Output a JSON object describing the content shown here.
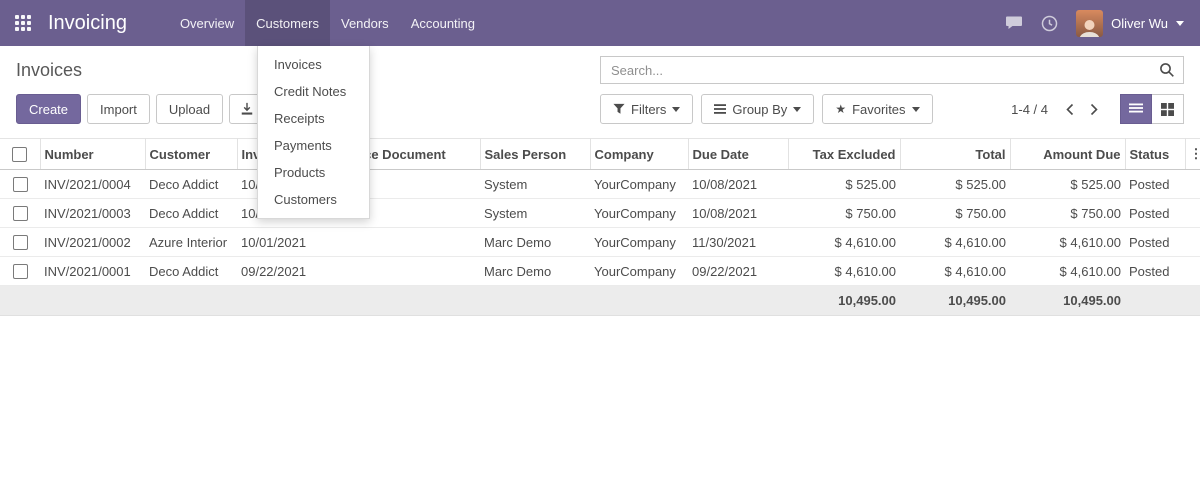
{
  "navbar": {
    "app_name": "Invoicing",
    "menus": [
      {
        "label": "Overview"
      },
      {
        "label": "Customers"
      },
      {
        "label": "Vendors"
      },
      {
        "label": "Accounting"
      }
    ],
    "user_name": "Oliver Wu"
  },
  "customers_menu": {
    "items": [
      "Invoices",
      "Credit Notes",
      "Receipts",
      "Payments",
      "Products",
      "Customers"
    ]
  },
  "control_panel": {
    "title": "Invoices",
    "search_placeholder": "Search...",
    "create_label": "Create",
    "import_label": "Import",
    "upload_label": "Upload",
    "filters_label": "Filters",
    "group_by_label": "Group By",
    "favorites_label": "Favorites",
    "pager": "1-4 / 4"
  },
  "table": {
    "headers": [
      "Number",
      "Customer",
      "Invoice Date",
      "Source Document",
      "Sales Person",
      "Company",
      "Due Date",
      "Tax Excluded",
      "Total",
      "Amount Due",
      "Status"
    ],
    "rows": [
      {
        "number": "INV/2021/0004",
        "customer": "Deco Addict",
        "invoice_date": "10/08/2021",
        "source_document": "",
        "sales_person": "System",
        "company": "YourCompany",
        "due_date": "10/08/2021",
        "tax_excluded": "$ 525.00",
        "total": "$ 525.00",
        "amount_due": "$ 525.00",
        "status": "Posted"
      },
      {
        "number": "INV/2021/0003",
        "customer": "Deco Addict",
        "invoice_date": "10/03/2021",
        "source_document": "",
        "sales_person": "System",
        "company": "YourCompany",
        "due_date": "10/08/2021",
        "tax_excluded": "$ 750.00",
        "total": "$ 750.00",
        "amount_due": "$ 750.00",
        "status": "Posted"
      },
      {
        "number": "INV/2021/0002",
        "customer": "Azure Interior",
        "invoice_date": "10/01/2021",
        "source_document": "",
        "sales_person": "Marc Demo",
        "company": "YourCompany",
        "due_date": "11/30/2021",
        "tax_excluded": "$ 4,610.00",
        "total": "$ 4,610.00",
        "amount_due": "$ 4,610.00",
        "status": "Posted"
      },
      {
        "number": "INV/2021/0001",
        "customer": "Deco Addict",
        "invoice_date": "09/22/2021",
        "source_document": "",
        "sales_person": "Marc Demo",
        "company": "YourCompany",
        "due_date": "09/22/2021",
        "tax_excluded": "$ 4,610.00",
        "total": "$ 4,610.00",
        "amount_due": "$ 4,610.00",
        "status": "Posted"
      }
    ],
    "footer": {
      "tax_excluded": "10,495.00",
      "total": "10,495.00",
      "amount_due": "10,495.00"
    }
  },
  "icons": {
    "star": "★",
    "ellipsis_v": "⋮"
  },
  "colors": {
    "navbar": "#6b5f8f",
    "primary": "#74689e"
  }
}
